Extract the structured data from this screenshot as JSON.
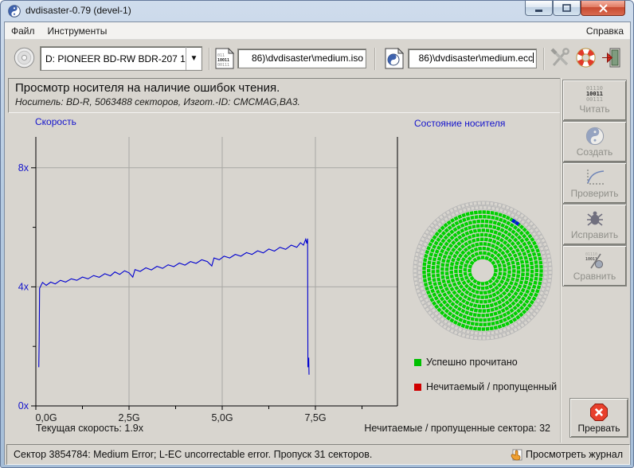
{
  "window": {
    "title": "dvdisaster-0.79 (devel-1)"
  },
  "menu": {
    "file": "Файл",
    "tools": "Инструменты",
    "help": "Справка"
  },
  "toolbar": {
    "drive_selected": "D: PIONEER BD-RW BDR-207 1",
    "iso_path": "86)\\dvdisaster\\medium.iso",
    "ecc_path": "86)\\dvdisaster\\medium.ecc"
  },
  "header": {
    "title": "Просмотр носителя на наличие ошибок чтения.",
    "subtitle": "Носитель: BD-R, 5063488 секторов, Изгот.-ID: CMCMAG,BA3."
  },
  "chart_data": {
    "type": "line",
    "title": "Скорость",
    "line_color": "#0000d0",
    "axis_color": "#000000",
    "grid_color": "#a8a8a4",
    "tick_label_color_y": "#1414cc",
    "tick_label_color_x": "#1c1c1c",
    "x_range": [
      0,
      9.7
    ],
    "y_range": [
      0,
      8.45
    ],
    "x_ticks": [
      {
        "g": 0,
        "label": "0,0G"
      },
      {
        "g": 2.5,
        "label": "2,5G"
      },
      {
        "g": 5,
        "label": "5,0G"
      },
      {
        "g": 7.5,
        "label": "7,5G"
      }
    ],
    "x_minor_ticks": [
      1.25,
      3.75,
      6.25,
      8.75
    ],
    "y_ticks": [
      {
        "v": 0,
        "label": "0x"
      },
      {
        "v": 4,
        "label": "4x"
      },
      {
        "v": 8,
        "label": "8x"
      }
    ],
    "y_minor_ticks": [
      2,
      6
    ],
    "points": [
      [
        0.08,
        1.3
      ],
      [
        0.09,
        2.2
      ],
      [
        0.1,
        3.95
      ],
      [
        0.18,
        4.15
      ],
      [
        0.28,
        4.05
      ],
      [
        0.4,
        4.16
      ],
      [
        0.52,
        4.1
      ],
      [
        0.66,
        4.22
      ],
      [
        0.8,
        4.16
      ],
      [
        0.95,
        4.27
      ],
      [
        1.1,
        4.22
      ],
      [
        1.25,
        4.33
      ],
      [
        1.4,
        4.27
      ],
      [
        1.55,
        4.38
      ],
      [
        1.7,
        4.32
      ],
      [
        1.85,
        4.44
      ],
      [
        2.0,
        4.37
      ],
      [
        2.12,
        4.5
      ],
      [
        2.25,
        4.42
      ],
      [
        2.38,
        4.54
      ],
      [
        2.5,
        4.47
      ],
      [
        2.6,
        4.33
      ],
      [
        2.66,
        4.58
      ],
      [
        2.8,
        4.52
      ],
      [
        2.95,
        4.64
      ],
      [
        3.1,
        4.57
      ],
      [
        3.25,
        4.69
      ],
      [
        3.4,
        4.62
      ],
      [
        3.55,
        4.74
      ],
      [
        3.7,
        4.68
      ],
      [
        3.85,
        4.8
      ],
      [
        4.0,
        4.73
      ],
      [
        4.15,
        4.85
      ],
      [
        4.3,
        4.79
      ],
      [
        4.45,
        4.91
      ],
      [
        4.6,
        4.85
      ],
      [
        4.72,
        4.7
      ],
      [
        4.78,
        4.97
      ],
      [
        4.92,
        4.91
      ],
      [
        5.05,
        5.03
      ],
      [
        5.2,
        4.97
      ],
      [
        5.35,
        5.09
      ],
      [
        5.5,
        5.03
      ],
      [
        5.65,
        5.15
      ],
      [
        5.8,
        5.09
      ],
      [
        5.95,
        5.21
      ],
      [
        6.1,
        5.14
      ],
      [
        6.25,
        5.27
      ],
      [
        6.4,
        5.2
      ],
      [
        6.55,
        5.33
      ],
      [
        6.7,
        5.26
      ],
      [
        6.85,
        5.4
      ],
      [
        7.0,
        5.33
      ],
      [
        7.1,
        5.48
      ],
      [
        7.18,
        5.4
      ],
      [
        7.24,
        5.6
      ],
      [
        7.27,
        5.46
      ],
      [
        7.29,
        5.62
      ],
      [
        7.3,
        1.3
      ],
      [
        7.32,
        1.62
      ],
      [
        7.33,
        1.05
      ]
    ]
  },
  "media": {
    "title": "Состояние носителя",
    "legend": [
      {
        "color": "#00c000",
        "label": "Успешно прочитано"
      },
      {
        "color": "#d00000",
        "label": "Нечитаемый / пропущенный"
      }
    ],
    "map": {
      "rings_total": 13,
      "rings_read": 11,
      "marker_ring": 10,
      "marker_angle_deg": -58,
      "read_color": "#00d000",
      "unread_stroke": "#b6b6b6",
      "marker_color": "#0018d8"
    }
  },
  "sidebar": {
    "buttons": [
      {
        "label": "Читать",
        "enabled": false
      },
      {
        "label": "Создать",
        "enabled": false
      },
      {
        "label": "Проверить",
        "enabled": false
      },
      {
        "label": "Исправить",
        "enabled": false
      },
      {
        "label": "Сравнить",
        "enabled": false
      }
    ],
    "abort_label": "Прервать"
  },
  "status": {
    "current_speed": "Текущая скорость: 1.9x",
    "unreadable": "Нечитаемые / пропущенные сектора: 32"
  },
  "footer": {
    "message": "Сектор 3854784: Medium Error; L-EC uncorrectable error. Пропуск 31 секторов.",
    "log_label": "Просмотреть журнал"
  }
}
